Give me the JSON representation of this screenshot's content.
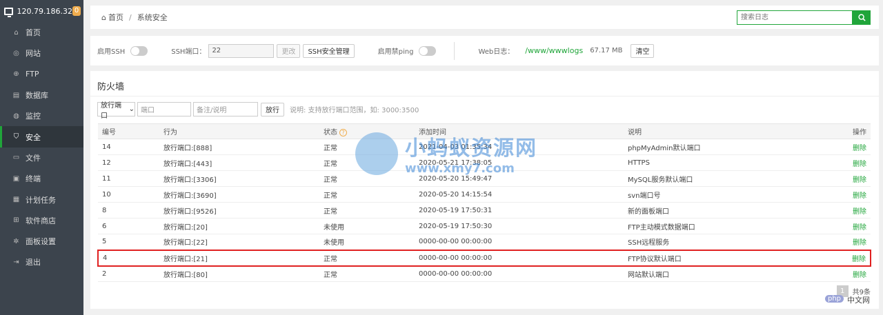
{
  "sidebar": {
    "ip": "120.79.186.32",
    "badge": "0",
    "items": [
      {
        "label": "首页",
        "icon": "home-icon",
        "glyph": "⌂"
      },
      {
        "label": "网站",
        "icon": "globe-icon",
        "glyph": "◎"
      },
      {
        "label": "FTP",
        "icon": "ftp-icon",
        "glyph": "⊕"
      },
      {
        "label": "数据库",
        "icon": "database-icon",
        "glyph": "▤"
      },
      {
        "label": "监控",
        "icon": "monitor-icon",
        "glyph": "◍"
      },
      {
        "label": "安全",
        "icon": "shield-icon",
        "glyph": "⛉"
      },
      {
        "label": "文件",
        "icon": "folder-icon",
        "glyph": "▭"
      },
      {
        "label": "终端",
        "icon": "terminal-icon",
        "glyph": "▣"
      },
      {
        "label": "计划任务",
        "icon": "calendar-icon",
        "glyph": "▦"
      },
      {
        "label": "软件商店",
        "icon": "apps-icon",
        "glyph": "⊞"
      },
      {
        "label": "面板设置",
        "icon": "gear-icon",
        "glyph": "✲"
      },
      {
        "label": "退出",
        "icon": "logout-icon",
        "glyph": "⇥"
      }
    ],
    "active_index": 5
  },
  "breadcrumb": {
    "home": "首页",
    "current": "系统安全"
  },
  "search": {
    "placeholder": "搜索日志"
  },
  "settings": {
    "ssh_label": "启用SSH",
    "ssh_port_label": "SSH端口：",
    "ssh_port_value": "22",
    "change_button": "更改",
    "ssh_manage_button": "SSH安全管理",
    "ping_label": "启用禁ping",
    "weblog_label": "Web日志：",
    "weblog_path": "/www/wwwlogs",
    "weblog_size": "67.17 MB",
    "clear_button": "清空"
  },
  "firewall": {
    "title": "防火墙",
    "select_value": "放行端口",
    "port_placeholder": "端口",
    "note_placeholder": "备注/说明",
    "allow_button": "放行",
    "hint": "说明: 支持放行端口范围，如: 3000:3500",
    "columns": [
      "编号",
      "行为",
      "状态",
      "添加时间",
      "说明",
      "操作"
    ],
    "rows": [
      {
        "id": "14",
        "action": "放行端口:[888]",
        "status": "正常",
        "time": "2021-04-03 01:35:34",
        "desc": "phpMyAdmin默认端口",
        "op": "删除"
      },
      {
        "id": "12",
        "action": "放行端口:[443]",
        "status": "正常",
        "time": "2020-05-21 17:38:05",
        "desc": "HTTPS",
        "op": "删除"
      },
      {
        "id": "11",
        "action": "放行端口:[3306]",
        "status": "正常",
        "time": "2020-05-20 15:49:47",
        "desc": "MySQL服务默认端口",
        "op": "删除"
      },
      {
        "id": "10",
        "action": "放行端口:[3690]",
        "status": "正常",
        "time": "2020-05-20 14:15:54",
        "desc": "svn端口号",
        "op": "删除"
      },
      {
        "id": "8",
        "action": "放行端口:[9526]",
        "status": "正常",
        "time": "2020-05-19 17:50:31",
        "desc": "新的面板端口",
        "op": "删除"
      },
      {
        "id": "6",
        "action": "放行端口:[20]",
        "status": "未使用",
        "time": "2020-05-19 17:50:30",
        "desc": "FTP主动模式数据端口",
        "op": "删除"
      },
      {
        "id": "5",
        "action": "放行端口:[22]",
        "status": "未使用",
        "time": "0000-00-00 00:00:00",
        "desc": "SSH远程服务",
        "op": "删除"
      },
      {
        "id": "4",
        "action": "放行端口:[21]",
        "status": "正常",
        "time": "0000-00-00 00:00:00",
        "desc": "FTP协议默认端口",
        "op": "删除"
      },
      {
        "id": "2",
        "action": "放行端口:[80]",
        "status": "正常",
        "time": "0000-00-00 00:00:00",
        "desc": "网站默认端口",
        "op": "删除"
      }
    ],
    "highlight_index": 7,
    "pager": {
      "page": "1",
      "total": "共9条"
    }
  },
  "watermark": {
    "cn": "小蚂蚁资源网",
    "url": "www.xmy7.com",
    "php": "php",
    "cn2": "中文网"
  },
  "colors": {
    "accent": "#20a53a",
    "highlight": "#e02020",
    "sidebar": "#3c444d"
  }
}
